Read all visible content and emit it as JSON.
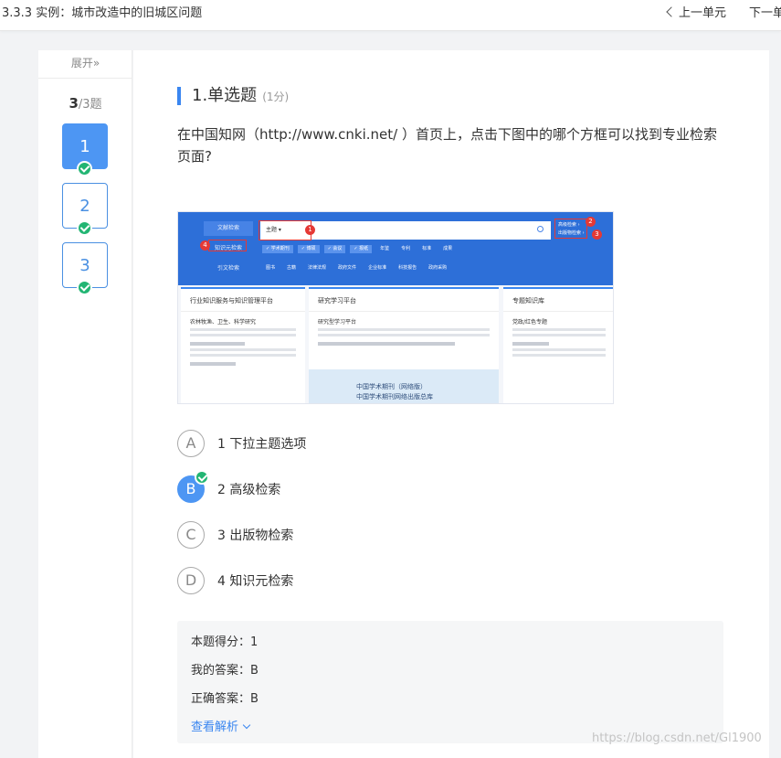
{
  "header": {
    "title": "3.3.3 实例：城市改造中的旧城区问题",
    "prev_unit": "上一单元",
    "next_unit": "下一单"
  },
  "sidebar": {
    "expand_label": "展开»",
    "current": "3",
    "total": "/3题",
    "questions": [
      {
        "label": "1",
        "state": "current",
        "answered": true
      },
      {
        "label": "2",
        "state": "normal",
        "answered": true
      },
      {
        "label": "3",
        "state": "normal",
        "answered": true
      }
    ]
  },
  "question": {
    "title": "1.单选题",
    "score": "(1分)",
    "stem": "在中国知网（http://www.cnki.net/ ）首页上，点击下图中的哪个方框可以找到专业检索页面?",
    "figure": {
      "side_tabs": [
        "文献检索",
        "知识元检索",
        "引文检索"
      ],
      "search_select": "主题 ▾",
      "right_links": [
        "高级检索 ›",
        "出版物检索 ›"
      ],
      "chips_row1": [
        "✓ 学术期刊",
        "✓ 博硕",
        "✓ 会议",
        "✓ 报纸",
        "年鉴",
        "专利",
        "标准",
        "成果"
      ],
      "chips_row2": [
        "图书",
        "古籍",
        "法律法规",
        "政府文件",
        "企业标准",
        "科技报告",
        "政府采购"
      ],
      "col_titles": [
        "行业知识服务与知识管理平台",
        "研究学习平台",
        "专题知识库"
      ],
      "col_headings": [
        "农林牧渔、卫生、科学研究",
        "研究型学习平台",
        "党政/红色专题"
      ],
      "banner_text": [
        "中国学术期刊（网络版）",
        "中国学术期刊网络出版总库"
      ],
      "markers": [
        "1",
        "2",
        "3",
        "4"
      ]
    },
    "options": [
      {
        "letter": "A",
        "text": "1 下拉主题选项",
        "selected": false
      },
      {
        "letter": "B",
        "text": "2 高级检索",
        "selected": true
      },
      {
        "letter": "C",
        "text": "3 出版物检索",
        "selected": false
      },
      {
        "letter": "D",
        "text": "4 知识元检索",
        "selected": false
      }
    ]
  },
  "result": {
    "score_line": "本题得分：1",
    "my_answer": "我的答案：B",
    "correct_answer": "正确答案：B",
    "analysis_link": "查看解析"
  },
  "watermark": "https://blog.csdn.net/Gl1900",
  "colors": {
    "accent": "#3a86f0",
    "success": "#22b573",
    "marker_red": "#e53935"
  }
}
